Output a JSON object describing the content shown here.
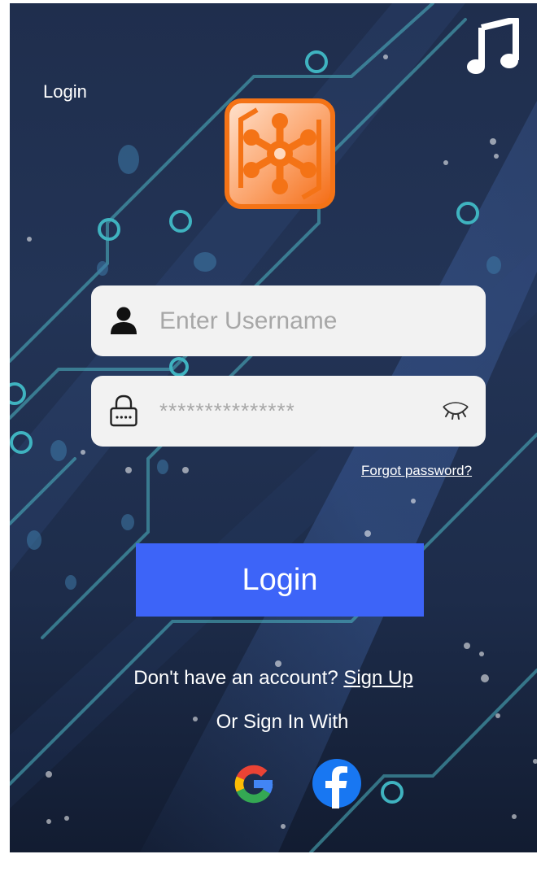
{
  "window": {
    "title": "Login"
  },
  "icons": {
    "music": "music-note-icon",
    "logo": "network-hub-logo",
    "user": "user-icon",
    "lock": "lock-icon",
    "eye": "eye-closed-icon",
    "google": "google-icon",
    "facebook": "facebook-icon"
  },
  "form": {
    "username_placeholder": "Enter Username",
    "username_value": "",
    "password_placeholder": "***************",
    "password_value": "",
    "forgot_label": "Forgot password?",
    "login_label": "Login"
  },
  "signup": {
    "prompt": "Don't have an account? ",
    "link_label": "Sign Up",
    "alt_text": "Or Sign In With"
  },
  "colors": {
    "background": "#223353",
    "accent": "#3d64f8",
    "logo_orange": "#f7781e",
    "field_bg": "#f2f2f2",
    "circuit_cyan": "#4fb8c4"
  }
}
